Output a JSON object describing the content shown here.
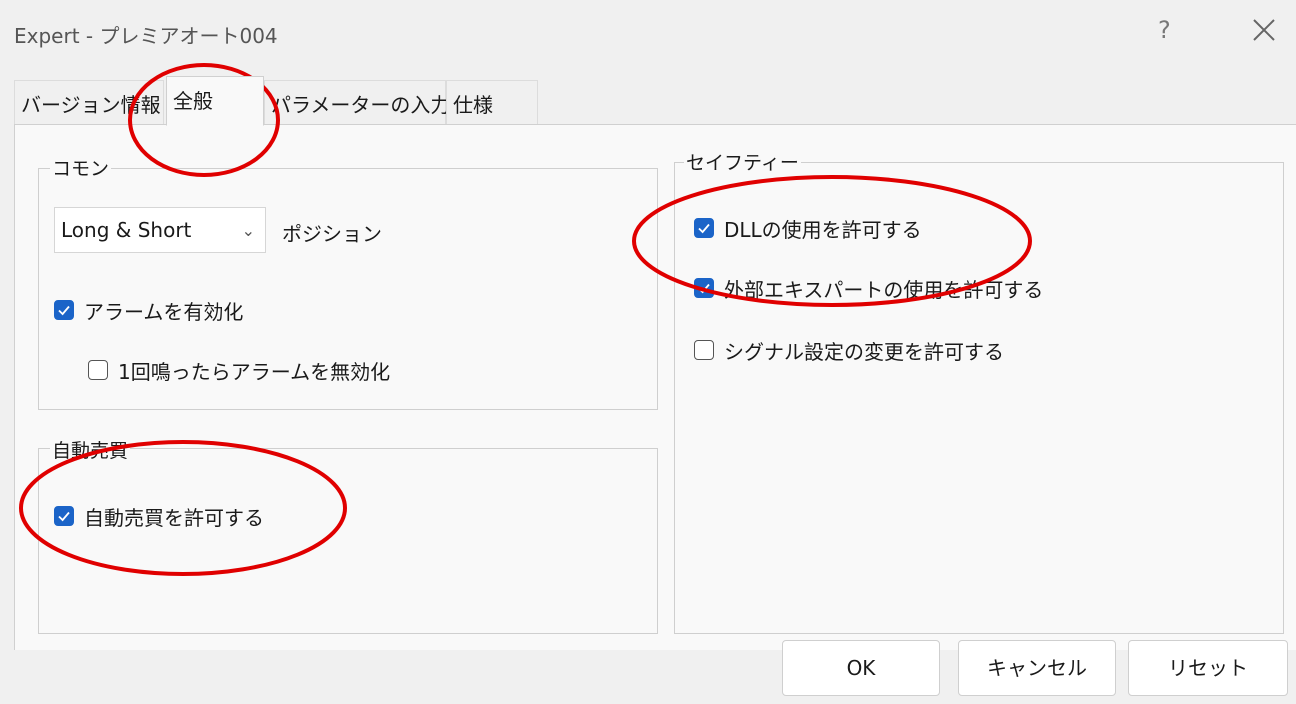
{
  "window": {
    "title": "Expert - プレミアオート004",
    "help_label": "?"
  },
  "tabs": [
    {
      "label": "バージョン情報"
    },
    {
      "label": "全般"
    },
    {
      "label": "パラメーターの入力"
    },
    {
      "label": "仕様"
    }
  ],
  "common": {
    "title": "コモン",
    "position_select_value": "Long & Short",
    "position_label": "ポジション",
    "enable_alarm_label": "アラームを有効化",
    "enable_alarm_checked": true,
    "disable_after_once_label": "1回鳴ったらアラームを無効化",
    "disable_after_once_checked": false
  },
  "auto_trading": {
    "title": "自動売買",
    "allow_label": "自動売買を許可する",
    "allow_checked": true
  },
  "safety": {
    "title": "セイフティー",
    "allow_dll_label": "DLLの使用を許可する",
    "allow_dll_checked": true,
    "allow_external_label": "外部エキスパートの使用を許可する",
    "allow_external_checked": true,
    "allow_signal_label": "シグナル設定の変更を許可する",
    "allow_signal_checked": false
  },
  "buttons": {
    "ok": "OK",
    "cancel": "キャンセル",
    "reset": "リセット"
  },
  "colors": {
    "accent": "#1b64c8",
    "annotation": "#e00000"
  }
}
